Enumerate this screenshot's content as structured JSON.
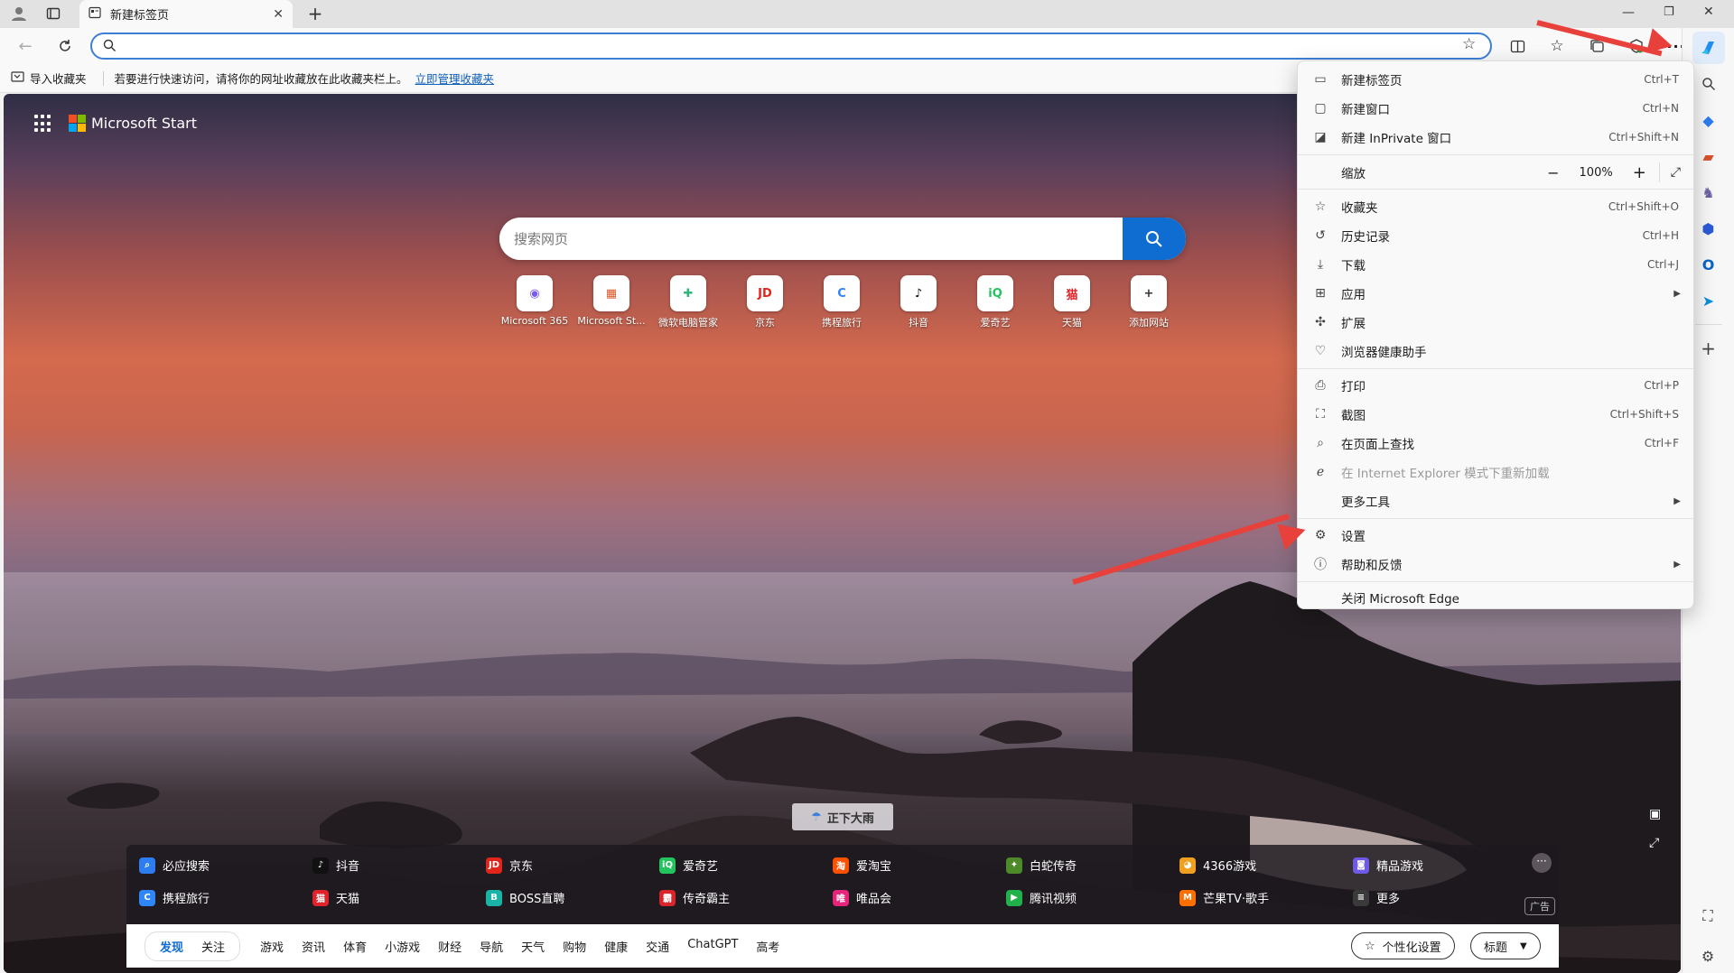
{
  "tab": {
    "title": "新建标签页"
  },
  "address": {
    "value": "",
    "placeholder": ""
  },
  "favbar": {
    "import_label": "导入收藏夹",
    "hint": "若要进行快速访问，请将你的网址收藏放在此收藏夹栏上。",
    "manage_link": "立即管理收藏夹"
  },
  "brand": {
    "name": "Microsoft Start"
  },
  "search": {
    "placeholder": "搜索网页"
  },
  "quicklinks": [
    {
      "label": "Microsoft 365",
      "icon": "m365-icon",
      "glyph": "◉",
      "color": "#7a5af5"
    },
    {
      "label": "Microsoft St...",
      "icon": "store-icon",
      "glyph": "▦",
      "color": "#d9582b"
    },
    {
      "label": "微软电脑管家",
      "icon": "pc-manager-icon",
      "glyph": "✚",
      "color": "#2fb67c"
    },
    {
      "label": "京东",
      "icon": "jd-icon",
      "glyph": "JD",
      "color": "#e1251b"
    },
    {
      "label": "携程旅行",
      "icon": "ctrip-icon",
      "glyph": "C",
      "color": "#2f86f6"
    },
    {
      "label": "抖音",
      "icon": "douyin-icon",
      "glyph": "♪",
      "color": "#111111"
    },
    {
      "label": "爱奇艺",
      "icon": "iqiyi-icon",
      "glyph": "iQ",
      "color": "#22c45e"
    },
    {
      "label": "天猫",
      "icon": "tmall-icon",
      "glyph": "猫",
      "color": "#e0232a"
    },
    {
      "label": "添加网站",
      "icon": "add-icon",
      "glyph": "+",
      "color": "#333333"
    }
  ],
  "weather": {
    "label": "正下大雨"
  },
  "links_row1": [
    {
      "label": "必应搜索",
      "icon": "bing-search-icon",
      "glyph": "⌕",
      "color": "#2d7cf0"
    },
    {
      "label": "抖音",
      "icon": "douyin-icon",
      "glyph": "♪",
      "color": "#111111"
    },
    {
      "label": "京东",
      "icon": "jd-icon",
      "glyph": "JD",
      "color": "#e1251b"
    },
    {
      "label": "爱奇艺",
      "icon": "iqiyi-icon",
      "glyph": "iQ",
      "color": "#22c45e"
    },
    {
      "label": "爱淘宝",
      "icon": "taobao-icon",
      "glyph": "淘",
      "color": "#ff5000"
    },
    {
      "label": "白蛇传奇",
      "icon": "game-icon",
      "glyph": "✦",
      "color": "#4c8a2a"
    },
    {
      "label": "4366游戏",
      "icon": "game4366-icon",
      "glyph": "◕",
      "color": "#f0a020"
    },
    {
      "label": "精品游戏",
      "icon": "gamepad-icon",
      "glyph": "◙",
      "color": "#6e5ae6"
    }
  ],
  "links_row2": [
    {
      "label": "携程旅行",
      "icon": "ctrip-icon",
      "glyph": "C",
      "color": "#2f86f6"
    },
    {
      "label": "天猫",
      "icon": "tmall-icon",
      "glyph": "猫",
      "color": "#e0232a"
    },
    {
      "label": "BOSS直聘",
      "icon": "boss-icon",
      "glyph": "B",
      "color": "#1ab4a6"
    },
    {
      "label": "传奇霸主",
      "icon": "legend-icon",
      "glyph": "霸",
      "color": "#d8242a"
    },
    {
      "label": "唯品会",
      "icon": "vip-icon",
      "glyph": "唯",
      "color": "#e6247a"
    },
    {
      "label": "腾讯视频",
      "icon": "tencent-video-icon",
      "glyph": "▶",
      "color": "#20b14b"
    },
    {
      "label": "芒果TV·歌手",
      "icon": "mgtv-icon",
      "glyph": "M",
      "color": "#ff6f00"
    },
    {
      "label": "更多",
      "icon": "menu-icon",
      "glyph": "≡",
      "color": "#3a3a3a"
    }
  ],
  "ad_label": "广告",
  "feed": {
    "tabs": [
      "发现",
      "关注",
      "游戏",
      "资讯",
      "体育",
      "小游戏",
      "财经",
      "导航",
      "天气",
      "购物",
      "健康",
      "交通",
      "ChatGPT",
      "高考"
    ],
    "personalize": "个性化设置",
    "layout": "标题"
  },
  "menu": {
    "new_tab": {
      "label": "新建标签页",
      "shortcut": "Ctrl+T"
    },
    "new_window": {
      "label": "新建窗口",
      "shortcut": "Ctrl+N"
    },
    "new_inprivate": {
      "label": "新建 InPrivate 窗口",
      "shortcut": "Ctrl+Shift+N"
    },
    "zoom": {
      "label": "缩放",
      "value": "100%"
    },
    "favorites": {
      "label": "收藏夹",
      "shortcut": "Ctrl+Shift+O"
    },
    "history": {
      "label": "历史记录",
      "shortcut": "Ctrl+H"
    },
    "downloads": {
      "label": "下载",
      "shortcut": "Ctrl+J"
    },
    "apps": {
      "label": "应用"
    },
    "extensions": {
      "label": "扩展"
    },
    "health": {
      "label": "浏览器健康助手"
    },
    "print": {
      "label": "打印",
      "shortcut": "Ctrl+P"
    },
    "screenshot": {
      "label": "截图",
      "shortcut": "Ctrl+Shift+S"
    },
    "find": {
      "label": "在页面上查找",
      "shortcut": "Ctrl+F"
    },
    "ie_mode": {
      "label": "在 Internet Explorer 模式下重新加载"
    },
    "more_tools": {
      "label": "更多工具"
    },
    "settings": {
      "label": "设置"
    },
    "help": {
      "label": "帮助和反馈"
    },
    "close": {
      "label": "关闭 Microsoft Edge"
    }
  },
  "colors": {
    "accent": "#0f6cd0",
    "annotation_arrow": "#e8403a"
  }
}
